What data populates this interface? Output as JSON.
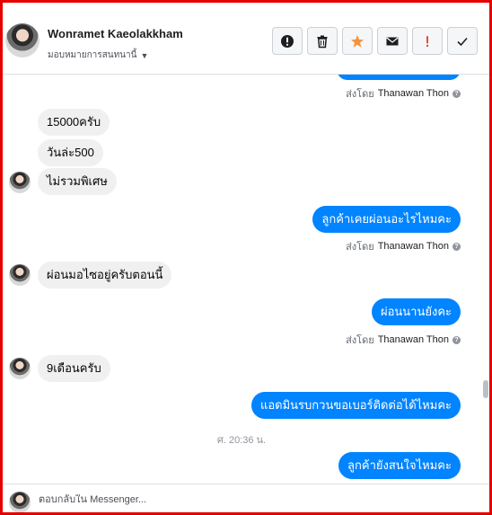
{
  "header": {
    "contact_name": "Wonramet Kaeolakkham",
    "assign_label": "มอบหมายการสนทนานี้",
    "actions": [
      {
        "name": "spam-button",
        "icon": "exclamation-circle-icon",
        "color": "#1c1e21"
      },
      {
        "name": "delete-button",
        "icon": "trash-icon",
        "color": "#1c1e21"
      },
      {
        "name": "star-button",
        "icon": "star-icon",
        "color": "#f5923e"
      },
      {
        "name": "email-button",
        "icon": "envelope-icon",
        "color": "#1c1e21"
      },
      {
        "name": "follow-up-button",
        "icon": "exclamation-icon",
        "color": "#e54b38"
      },
      {
        "name": "done-button",
        "icon": "check-icon",
        "color": "#1c1e21"
      }
    ]
  },
  "colors": {
    "outgoing": "#0084ff",
    "incoming": "#f1f0f0",
    "frame": "#e60000"
  },
  "messages": [
    {
      "type": "incoming",
      "text": "15000ครับ"
    },
    {
      "type": "incoming",
      "text": "วันล่ะ500"
    },
    {
      "type": "incoming",
      "text": "ไม่รวมพิเศษ"
    },
    {
      "type": "outgoing",
      "text": "ลูกค้าเคยผ่อนอะไรไหมคะ"
    },
    {
      "type": "incoming",
      "text": "ผ่อนมอไซอยู่ครับตอนนี้"
    },
    {
      "type": "outgoing",
      "text": "ผ่อนนานยังคะ"
    },
    {
      "type": "incoming",
      "text": "9เดือนครับ"
    },
    {
      "type": "outgoing",
      "text": "แอดมินรบกวนขอเบอร์ติดต่อได้ไหมคะ"
    },
    {
      "type": "outgoing",
      "text": "ลูกค้ายังสนใจไหมคะ"
    }
  ],
  "sent_by": {
    "prefix": "ส่งโดย",
    "agent": "Thanawan Thon"
  },
  "timestamp": "ศ. 20:36 น.",
  "composer": {
    "placeholder": "ตอบกลับใน Messenger..."
  }
}
